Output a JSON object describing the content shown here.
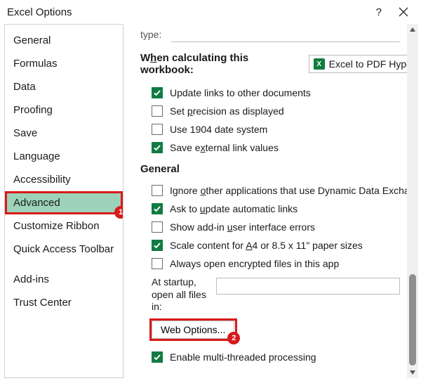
{
  "window": {
    "title": "Excel Options",
    "help": "?",
    "close": "×"
  },
  "sidebar": {
    "items": [
      {
        "label": "General"
      },
      {
        "label": "Formulas"
      },
      {
        "label": "Data"
      },
      {
        "label": "Proofing"
      },
      {
        "label": "Save"
      },
      {
        "label": "Language"
      },
      {
        "label": "Accessibility"
      },
      {
        "label": "Advanced",
        "selected": true,
        "callout": "1"
      },
      {
        "label": "Customize Ribbon"
      },
      {
        "label": "Quick Access Toolbar"
      },
      {
        "label": "Add-ins"
      },
      {
        "label": "Trust Center"
      }
    ]
  },
  "content": {
    "type_label": "type:",
    "calc_heading_before": "W",
    "calc_heading_u": "h",
    "calc_heading_after": "en calculating this workbook:",
    "workbook_name": "Excel to PDF Hype",
    "calc_options": [
      {
        "checked": true,
        "text": "Update links to other documents"
      },
      {
        "checked": false,
        "text_before": "Set ",
        "u": "p",
        "text_after": "recision as displayed"
      },
      {
        "checked": false,
        "text": "Use 1904 date system"
      },
      {
        "checked": true,
        "text_before": "Save e",
        "u": "x",
        "text_after": "ternal link values"
      }
    ],
    "general_heading": "General",
    "general_options": [
      {
        "checked": false,
        "text_before": "Ignore ",
        "u": "o",
        "text_after": "ther applications that use Dynamic Data Excha"
      },
      {
        "checked": true,
        "text_before": "Ask to ",
        "u": "u",
        "text_after": "pdate automatic links"
      },
      {
        "checked": false,
        "text_before": "Show add-in ",
        "u": "u",
        "text_after": "ser interface errors"
      },
      {
        "checked": true,
        "text_before": "Scale content for ",
        "u": "A",
        "text_after": "4 or 8.5 x 11\" paper sizes"
      },
      {
        "checked": false,
        "text": "Always open encrypted files in this app"
      }
    ],
    "startup_label": "At startup, open all files in:",
    "startup_value": "",
    "web_options_label": "Web Options...",
    "web_options_callout": "2",
    "multithread": {
      "checked": true,
      "text": "Enable multi-threaded processing"
    }
  }
}
